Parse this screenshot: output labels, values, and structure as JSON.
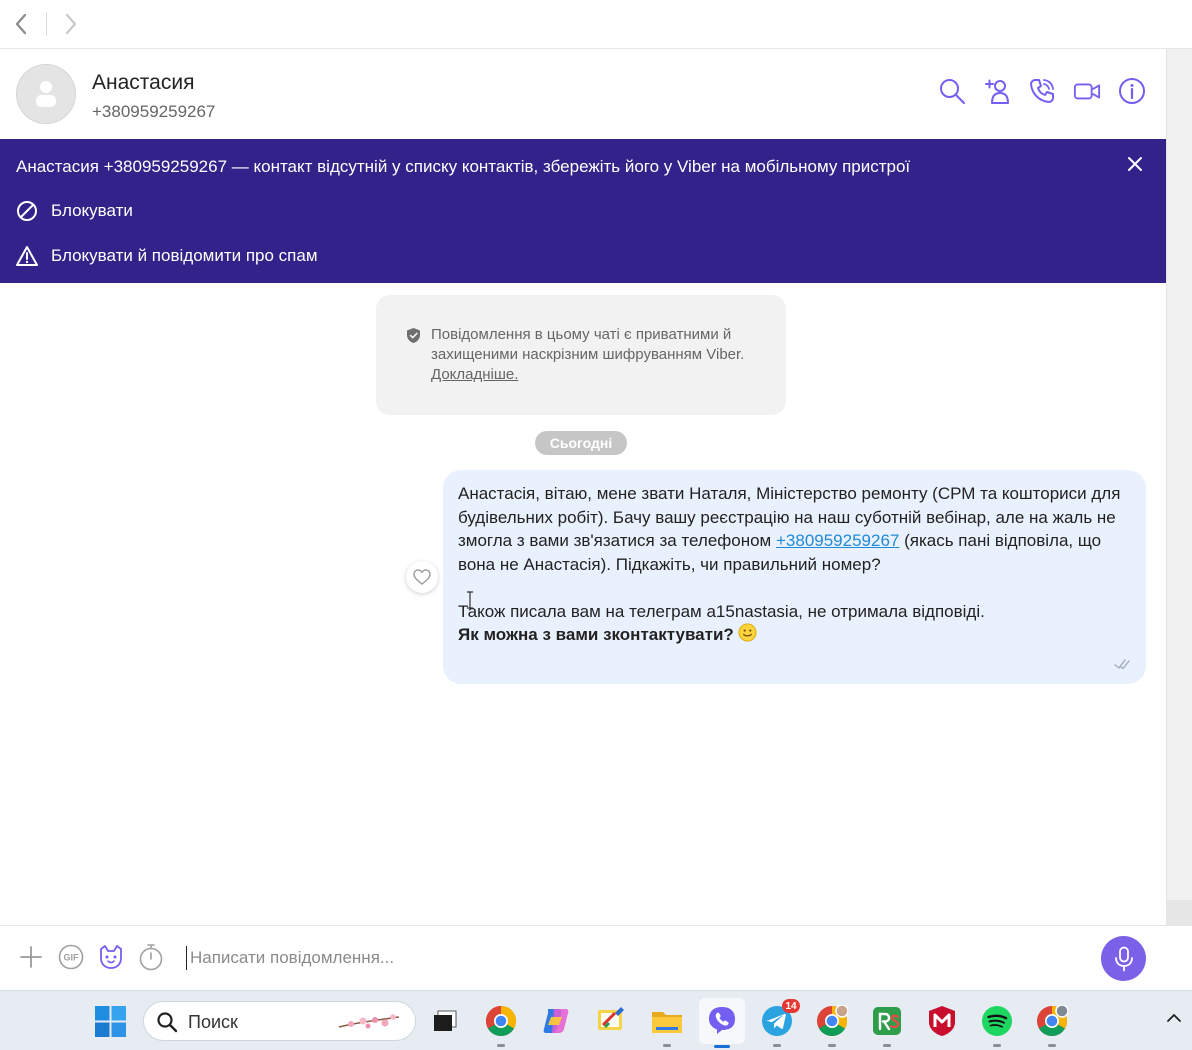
{
  "nav": {
    "back": "back",
    "forward": "forward"
  },
  "contact": {
    "name": "Анастасия",
    "phone": "+380959259267"
  },
  "header_icons": [
    "search-icon",
    "add-participant-icon",
    "call-icon",
    "video-call-icon",
    "info-icon"
  ],
  "banner": {
    "message": "Анастасия +380959259267 — контакт відсутній у списку контактів, збережіть його у Viber на мобільному пристрої",
    "block_label": "Блокувати",
    "block_spam_label": "Блокувати й повідомити про спам",
    "bg_color": "#33228a"
  },
  "e2e_notice": {
    "text": "Повідомлення в цьому чаті є приватними й захищеними наскрізним шифруванням Viber.",
    "link": "Докладніше."
  },
  "date_separator": "Сьогодні",
  "message": {
    "part1": "Анастасія, вітаю, мене звати Наталя, Міністерство ремонту (СРМ та кошториси для будівельних робіт). Бачу вашу реєстрацію на наш суботній вебінар, але на жаль не змогла з вами зв'язатися за телефоном ",
    "link": "+380959259267",
    "part2": " (якась пані відповіла, що вона не Анастасія). Підкажіть, чи правильний номер?",
    "line2": "Також писала вам на телеграм a15nastasia, не отримала відповіді.",
    "bold_line": "Як можна з вами зконтактувати?",
    "emoji": "smile-emoji",
    "status": "seen",
    "bubble_color": "#eaf1fe"
  },
  "composer": {
    "placeholder": "Написати повідомлення...",
    "icons": [
      "plus-icon",
      "gif-icon",
      "sticker-icon",
      "timer-icon",
      "microphone-icon"
    ],
    "mic_color": "#7b61e8"
  },
  "taskbar": {
    "search_label": "Поиск",
    "apps": [
      "start",
      "task-view",
      "chrome",
      "copilot",
      "paint",
      "file-explorer",
      "viber",
      "telegram",
      "chrome-profile",
      "rs-app",
      "mcafee",
      "spotify",
      "chrome-profile-2"
    ],
    "telegram_badge": "14"
  }
}
